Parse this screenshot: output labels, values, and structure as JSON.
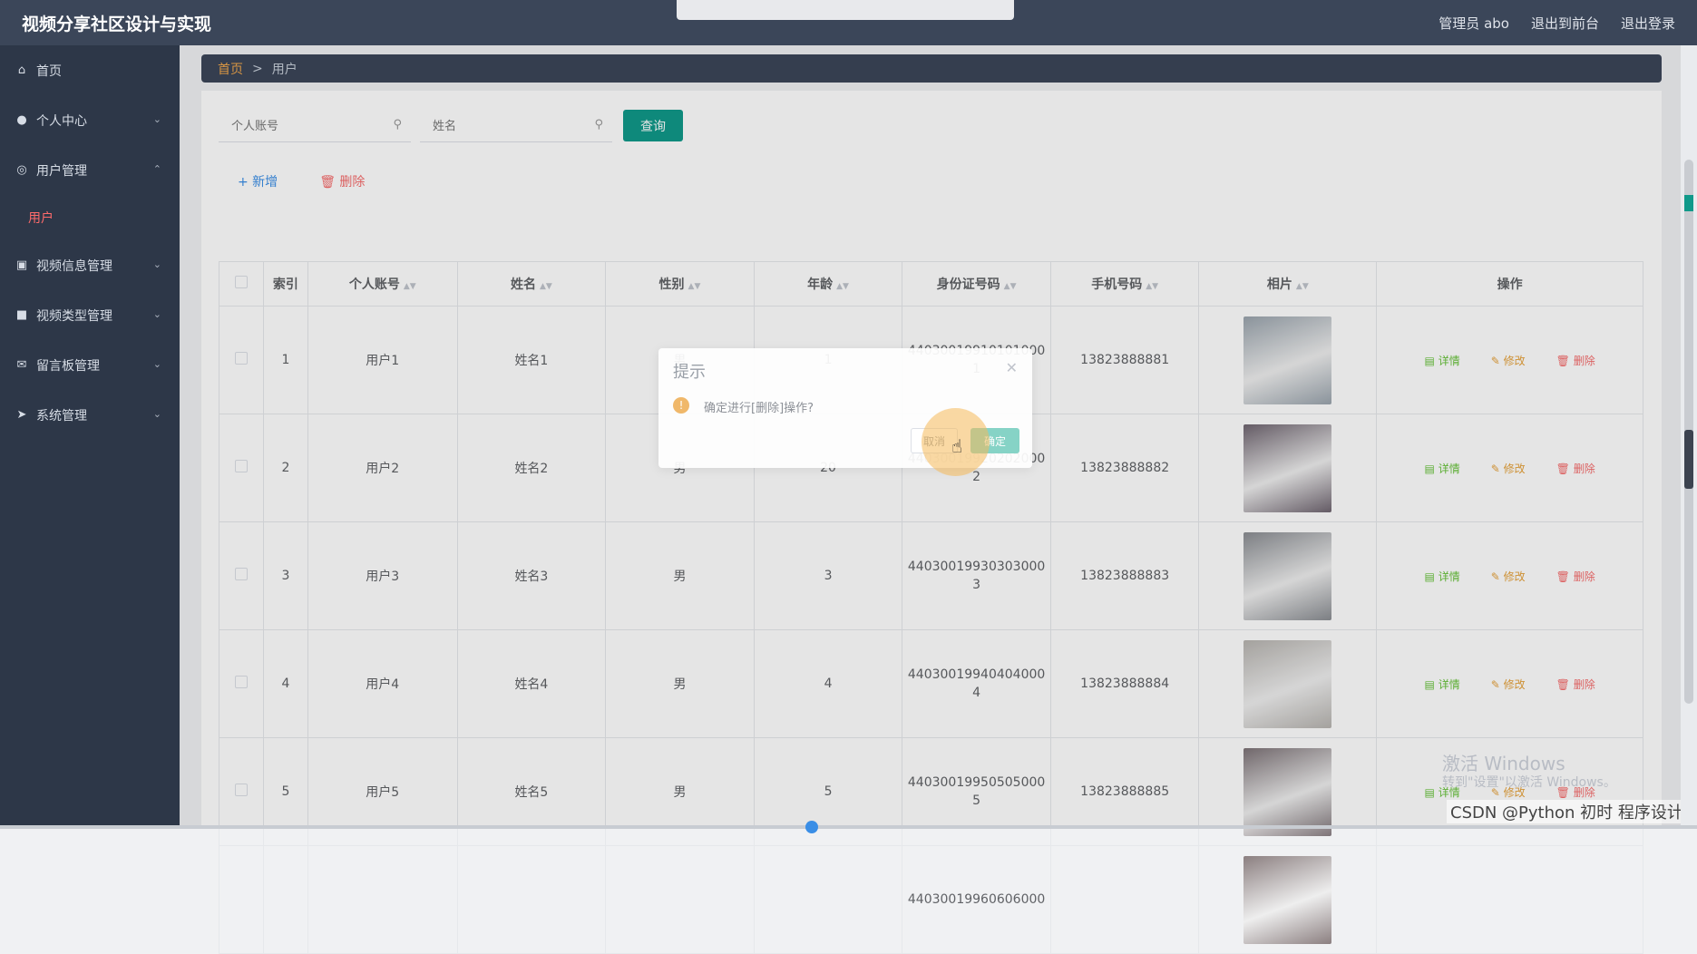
{
  "app": {
    "title": "视频分享社区设计与实现"
  },
  "topbar": {
    "admin_label": "管理员 abo",
    "back_label": "退出到前台",
    "logout_label": "退出登录"
  },
  "sidebar": {
    "items": [
      {
        "label": "首页",
        "icon": "home-icon"
      },
      {
        "label": "个人中心",
        "icon": "user-icon"
      },
      {
        "label": "用户管理",
        "icon": "users-icon"
      },
      {
        "label": "视频信息管理",
        "icon": "chart-icon"
      },
      {
        "label": "视频类型管理",
        "icon": "video-icon"
      },
      {
        "label": "留言板管理",
        "icon": "mail-icon"
      },
      {
        "label": "系统管理",
        "icon": "send-icon"
      }
    ],
    "active_sub": "用户"
  },
  "breadcrumb": {
    "home": "首页",
    "separator": ">",
    "current": "用户"
  },
  "search": {
    "account_placeholder": "个人账号",
    "name_placeholder": "姓名",
    "query_label": "查询"
  },
  "actions": {
    "add_label": "+ 新增",
    "delete_label": "删除"
  },
  "table": {
    "headers": [
      "索引",
      "个人账号",
      "姓名",
      "性别",
      "年龄",
      "身份证号码",
      "手机号码",
      "相片",
      "操作"
    ],
    "rows": [
      {
        "index": "1",
        "account": "用户1",
        "name": "姓名1",
        "gender": "男",
        "age": "1",
        "id_line1": "44030019910101000",
        "id_line2": "1",
        "phone": "13823888881"
      },
      {
        "index": "2",
        "account": "用户2",
        "name": "姓名2",
        "gender": "男",
        "age": "20",
        "id_line1": "44030019920202000",
        "id_line2": "2",
        "phone": "13823888882"
      },
      {
        "index": "3",
        "account": "用户3",
        "name": "姓名3",
        "gender": "男",
        "age": "3",
        "id_line1": "44030019930303000",
        "id_line2": "3",
        "phone": "13823888883"
      },
      {
        "index": "4",
        "account": "用户4",
        "name": "姓名4",
        "gender": "男",
        "age": "4",
        "id_line1": "44030019940404000",
        "id_line2": "4",
        "phone": "13823888884"
      },
      {
        "index": "5",
        "account": "用户5",
        "name": "姓名5",
        "gender": "男",
        "age": "5",
        "id_line1": "44030019950505000",
        "id_line2": "5",
        "phone": "13823888885"
      },
      {
        "index": "",
        "account": "",
        "name": "",
        "gender": "",
        "age": "",
        "id_line1": "44030019960606000",
        "id_line2": "",
        "phone": ""
      }
    ],
    "op_detail": "详情",
    "op_edit": "修改",
    "op_delete": "删除"
  },
  "dialog": {
    "title": "提示",
    "message": "确定进行[删除]操作?",
    "cancel": "取消",
    "confirm": "确定"
  },
  "watermark": {
    "line1": "激活 Windows",
    "line2": "转到\"设置\"以激活 Windows。",
    "csdn": "CSDN @Python 初时 程序设计"
  },
  "colors": {
    "sidebar_bg": "#2d3748",
    "topbar_bg": "#3b4659",
    "primary": "#10998a",
    "danger": "#f56c6c",
    "warning": "#e6a23c",
    "success": "#67c23a"
  }
}
